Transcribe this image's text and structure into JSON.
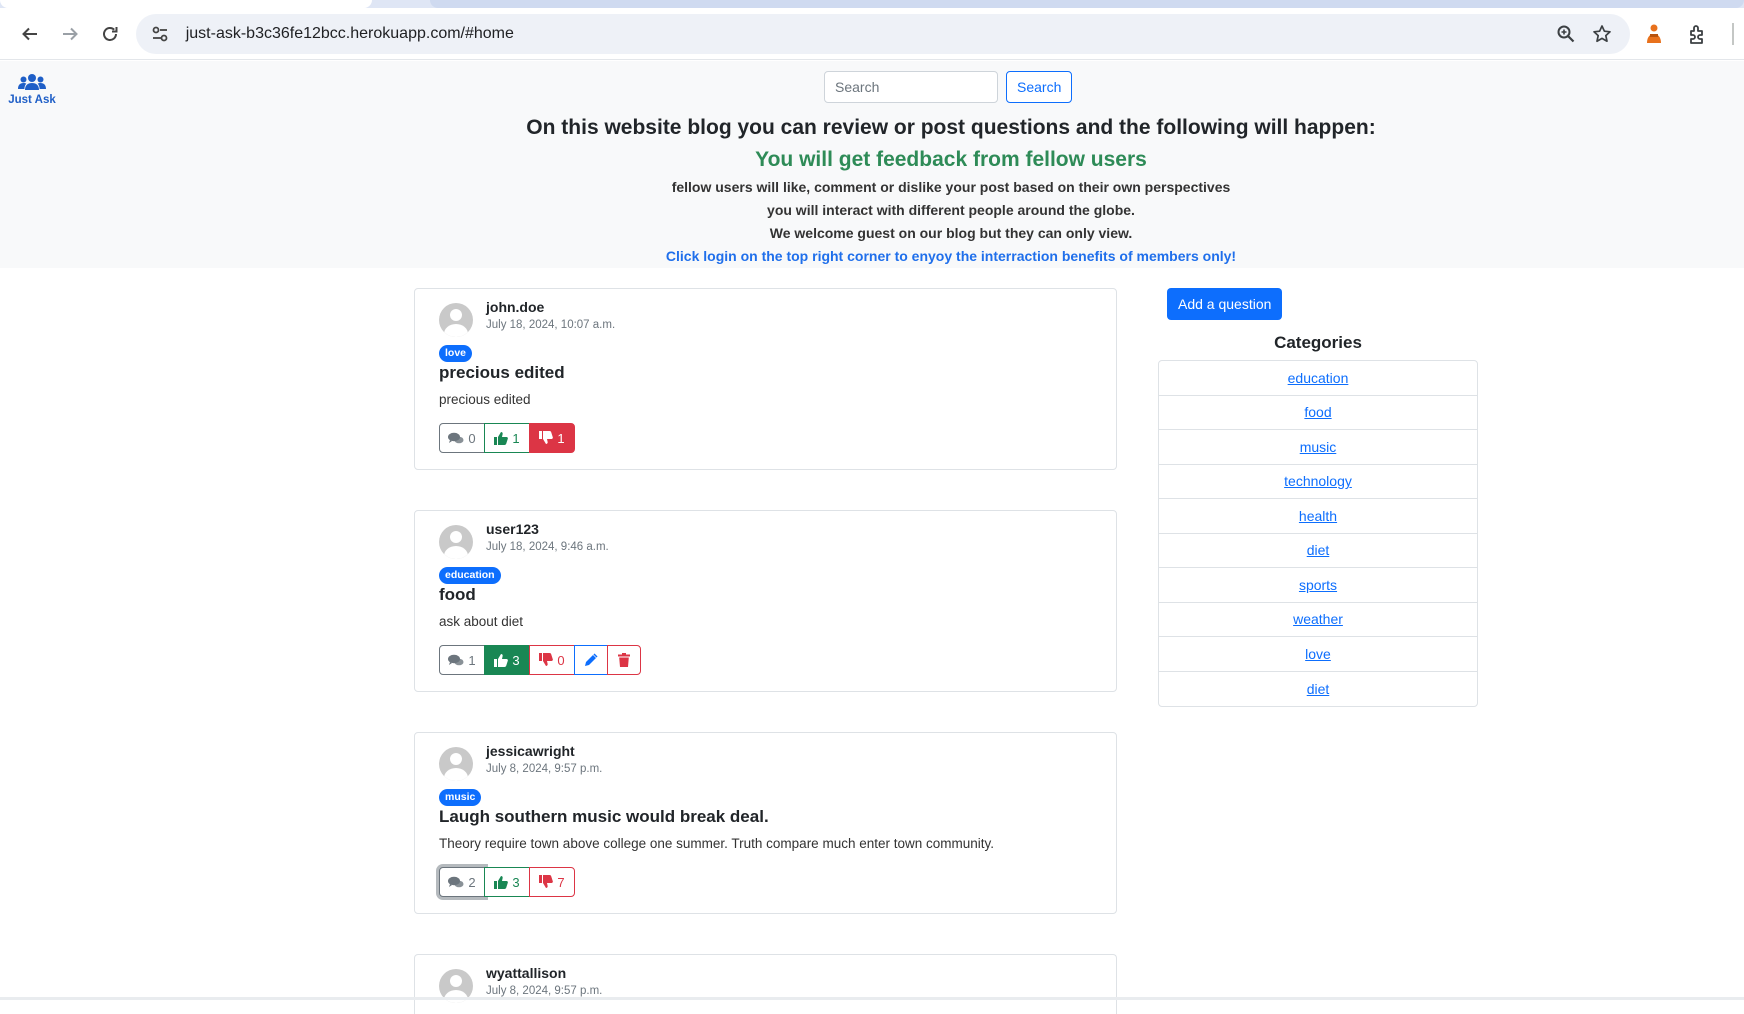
{
  "browser": {
    "url": "just-ask-b3c36fe12bcc.herokuapp.com/#home"
  },
  "brand": {
    "label": "Just Ask"
  },
  "search": {
    "placeholder": "Search",
    "button_label": "Search"
  },
  "hero": {
    "title": "On this website blog you can review or post questions and the following will happen:",
    "subtitle": "You will get feedback from fellow users",
    "lines": [
      "fellow users will like, comment or dislike your post based on their own perspectives",
      "you will interact with different people around the globe.",
      "We welcome guest on our blog but they can only view."
    ],
    "cta": "Click login on the top right corner to enyoy the interraction benefits of members only!"
  },
  "posts": [
    {
      "author": "john.doe",
      "date": "July 18, 2024, 10:07 a.m.",
      "category": "love",
      "title": "precious edited",
      "body": "precious edited",
      "comments": "0",
      "likes": "1",
      "dislikes": "1"
    },
    {
      "author": "user123",
      "date": "July 18, 2024, 9:46 a.m.",
      "category": "education",
      "title": "food",
      "body": "ask about diet",
      "comments": "1",
      "likes": "3",
      "dislikes": "0"
    },
    {
      "author": "jessicawright",
      "date": "July 8, 2024, 9:57 p.m.",
      "category": "music",
      "title": "Laugh southern music would break deal.",
      "body": "Theory require town above college one summer. Truth compare much enter town community.",
      "comments": "2",
      "likes": "3",
      "dislikes": "7"
    },
    {
      "author": "wyattallison",
      "date": "July 8, 2024, 9:57 p.m."
    }
  ],
  "sidebar": {
    "add_question_label": "Add a question",
    "categories_heading": "Categories",
    "categories": [
      "education",
      "food",
      "music",
      "technology",
      "health",
      "diet",
      "sports",
      "weather",
      "love",
      "diet"
    ]
  },
  "colors": {
    "primary": "#0d6efd",
    "success": "#198754",
    "danger": "#dc3545",
    "hero_subtitle": "#2e8b57",
    "hero_background": "#f8f9fa"
  }
}
